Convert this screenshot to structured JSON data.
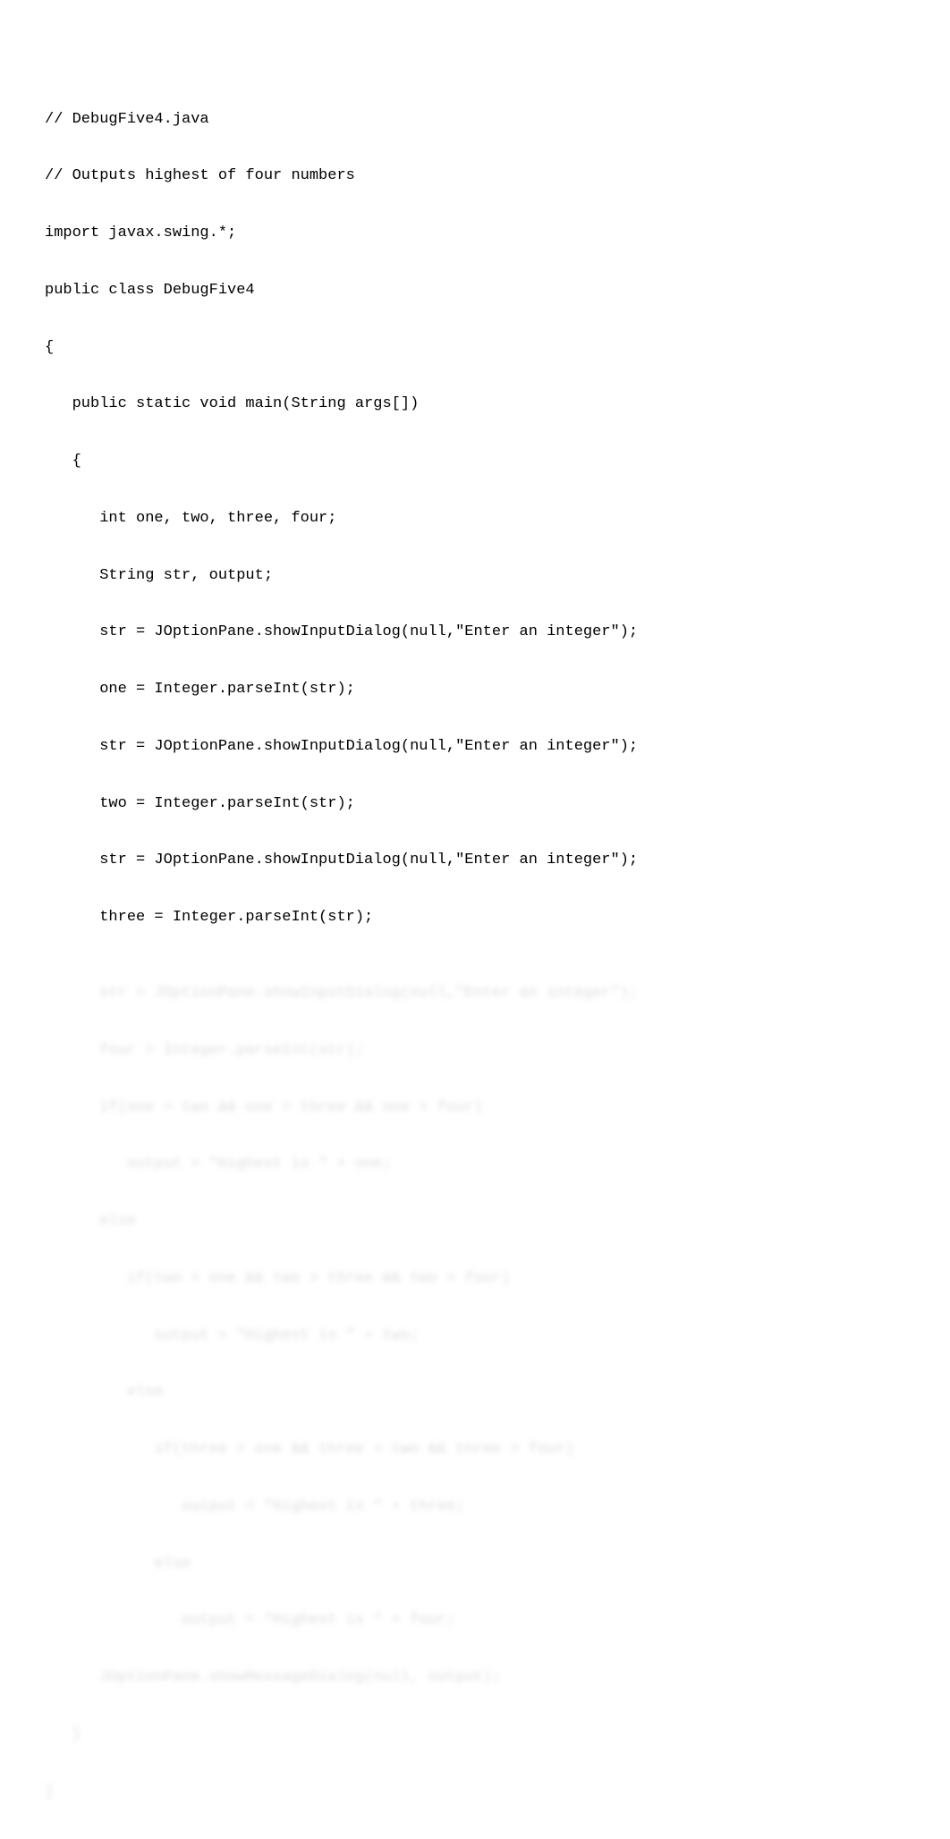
{
  "code": {
    "visible_lines": [
      "// DebugFive4.java",
      "// Outputs highest of four numbers",
      "import javax.swing.*;",
      "public class DebugFive4",
      "{",
      "   public static void main(String args[])",
      "   {",
      "      int one, two, three, four;",
      "      String str, output;",
      "      str = JOptionPane.showInputDialog(null,\"Enter an integer\");",
      "      one = Integer.parseInt(str);",
      "      str = JOptionPane.showInputDialog(null,\"Enter an integer\");",
      "      two = Integer.parseInt(str);",
      "      str = JOptionPane.showInputDialog(null,\"Enter an integer\");",
      "      three = Integer.parseInt(str);"
    ],
    "obscured_lines": [
      "      str = JOptionPane.showInputDialog(null,\"Enter an integer\");",
      "      four = Integer.parseInt(str);",
      "      if(one > two && one > three && one > four)",
      "         output = \"Highest is \" + one;",
      "      else",
      "         if(two > one && two > three && two > four)",
      "            output = \"Highest is \" + two;",
      "         else",
      "            if(three > one && three > two && three > four)",
      "               output = \"Highest is \" + three;",
      "            else",
      "               output = \"Highest is \" + four;",
      "      JOptionPane.showMessageDialog(null, output);",
      "   }",
      "}"
    ]
  }
}
